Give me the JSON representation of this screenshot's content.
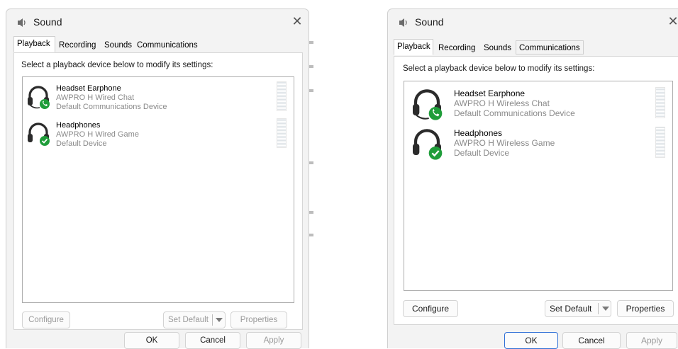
{
  "left_dialog": {
    "title": "Sound",
    "close_glyph": "✕",
    "tabs": [
      "Playback",
      "Recording",
      "Sounds",
      "Communications"
    ],
    "instruction": "Select a playback device below to modify its settings:",
    "devices": [
      {
        "name": "Headset Earphone",
        "model": "AWPRO H Wired Chat",
        "status": "Default Communications Device",
        "badge": "phone-icon"
      },
      {
        "name": "Headphones",
        "model": "AWPRO H Wired Game",
        "status": "Default Device",
        "badge": "checkmark-icon"
      }
    ],
    "buttons": {
      "configure": "Configure",
      "set_default": "Set Default",
      "properties": "Properties",
      "ok": "OK",
      "cancel": "Cancel",
      "apply": "Apply"
    }
  },
  "right_dialog": {
    "title": "Sound",
    "close_glyph": "✕",
    "tabs": [
      "Playback",
      "Recording",
      "Sounds",
      "Communications"
    ],
    "instruction": "Select a playback device below to modify its settings:",
    "devices": [
      {
        "name": "Headset Earphone",
        "model": "AWPRO H Wireless Chat",
        "status": "Default Communications Device",
        "badge": "phone-icon"
      },
      {
        "name": "Headphones",
        "model": "AWPRO H Wireless Game",
        "status": "Default Device",
        "badge": "checkmark-icon"
      }
    ],
    "buttons": {
      "configure": "Configure",
      "set_default": "Set Default",
      "properties": "Properties",
      "ok": "OK",
      "cancel": "Cancel",
      "apply": "Apply"
    }
  },
  "colors": {
    "badge_green": "#1f9d3a",
    "accent_blue": "#2f6fd6",
    "window_bg": "#f3f3f3"
  }
}
